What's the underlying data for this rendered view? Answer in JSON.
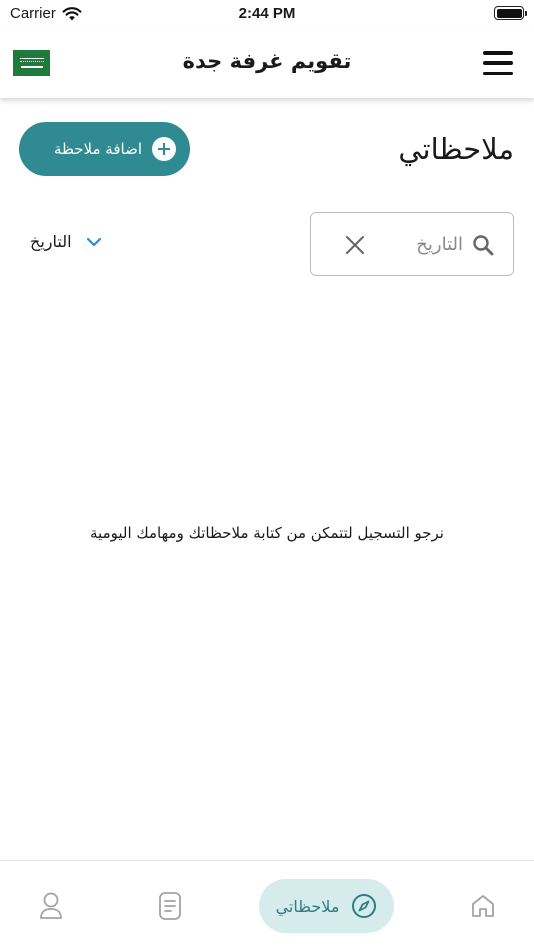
{
  "status_bar": {
    "carrier": "Carrier",
    "time": "2:44 PM"
  },
  "header": {
    "title": "تقويم غرفة جدة",
    "flag_icon": "saudi-flag-icon",
    "menu_icon": "hamburger-menu-icon"
  },
  "page": {
    "title": "ملاحظاتي",
    "add_button_label": "اضافة ملاحظة"
  },
  "search": {
    "placeholder": "التاريخ",
    "value": ""
  },
  "sort": {
    "label": "التاريخ"
  },
  "empty_message": "نرجو التسجيل لتتمكن من كتابة ملاحظاتك ومهامك اليومية",
  "bottom_nav": {
    "active": "notes",
    "items": [
      {
        "id": "profile",
        "icon": "user-icon"
      },
      {
        "id": "notes-list",
        "icon": "document-icon"
      },
      {
        "id": "notes",
        "icon": "compass-icon",
        "label": "ملاحظاتي"
      },
      {
        "id": "home",
        "icon": "home-icon"
      }
    ]
  },
  "colors": {
    "accent": "#2f8a91",
    "active_nav_bg": "#d6ecec",
    "flag_green": "#1f7a3c",
    "chevron_blue": "#2e8bd6"
  }
}
